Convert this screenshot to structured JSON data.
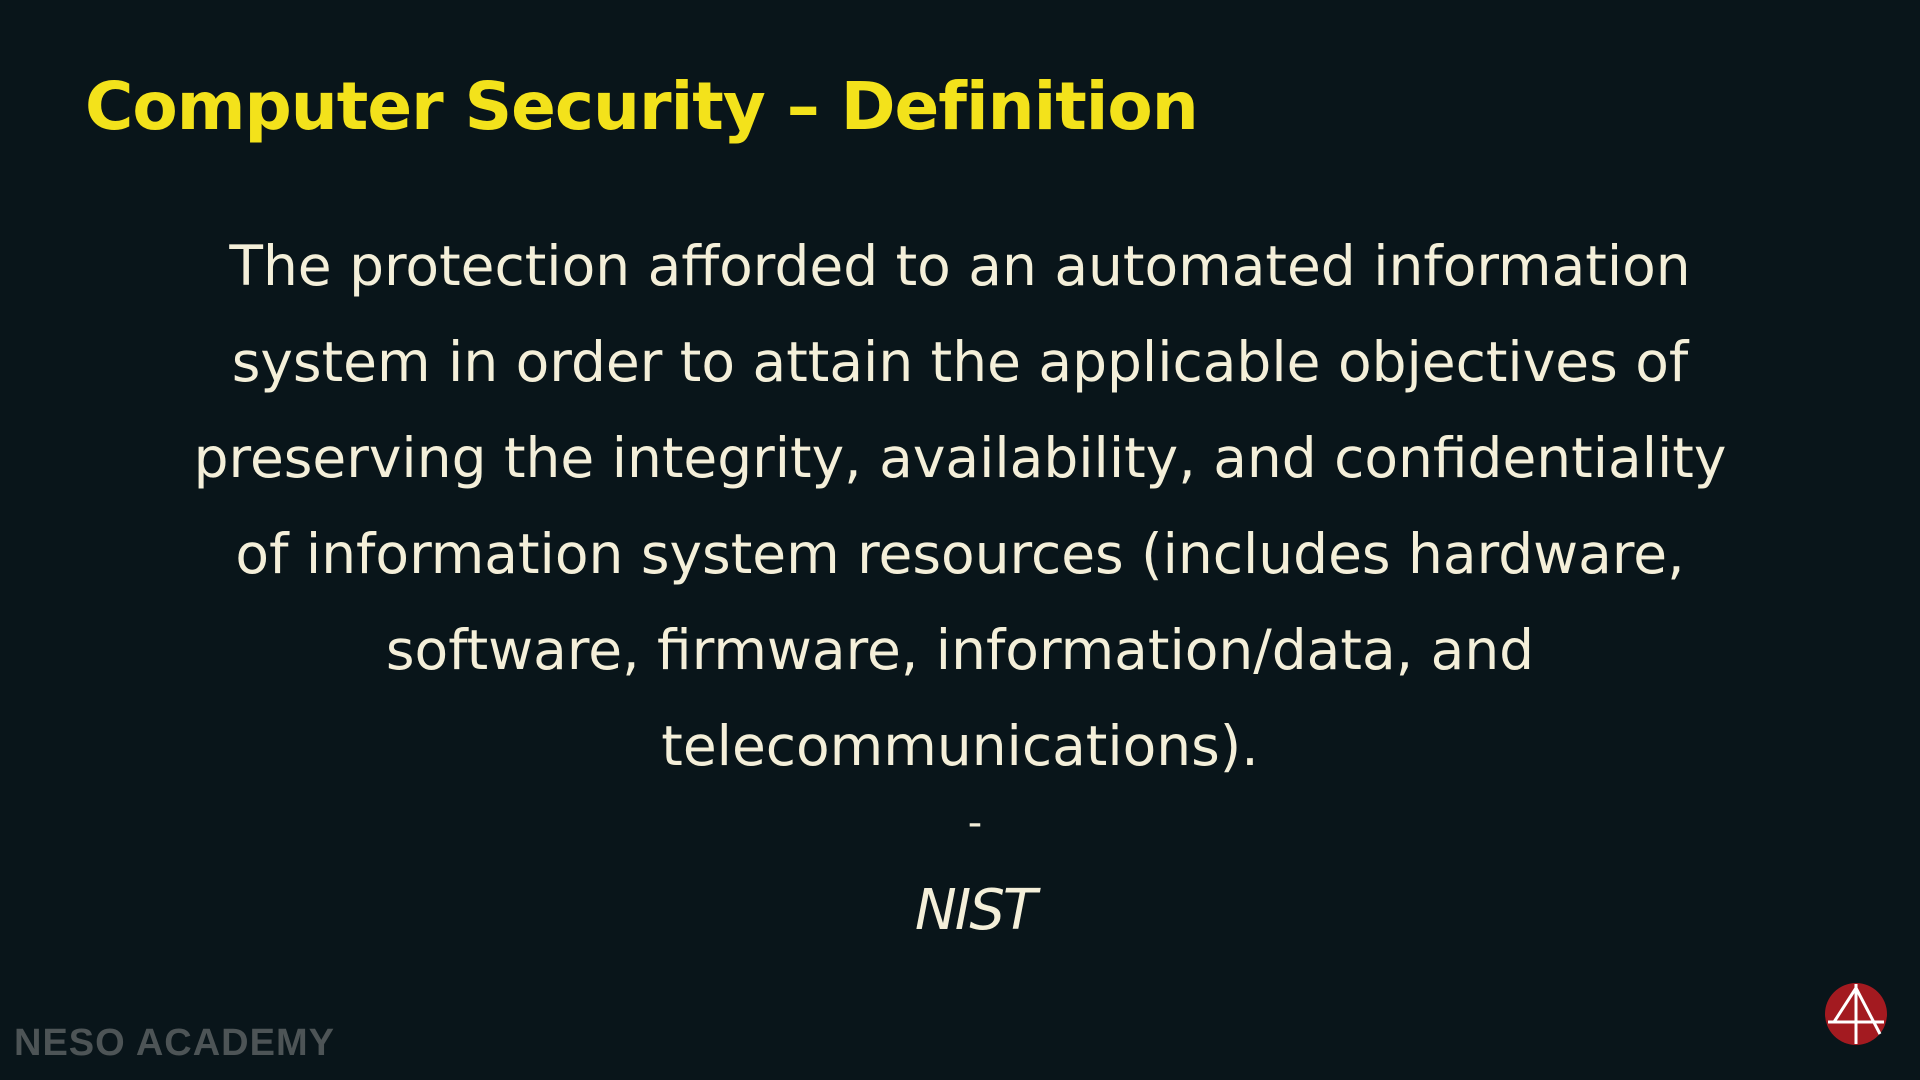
{
  "slide": {
    "title": "Computer Security – Definition",
    "definition_lines": [
      "The protection afforded to an automated information",
      "system in order to attain the applicable objectives of",
      "preserving the integrity, availability, and confidentiality",
      "of information system resources (includes hardware,",
      "software, firmware, information/data, and",
      "telecommunications)."
    ],
    "dash": "-",
    "source": "NIST"
  },
  "branding": {
    "watermark": "NESO ACADEMY",
    "logo_icon": "neso-academy-logo-icon"
  },
  "colors": {
    "background": "#09151a",
    "title": "#f3e21b",
    "body_text": "#f4efd9",
    "watermark": "#4d5456",
    "logo": "#a31a20"
  }
}
